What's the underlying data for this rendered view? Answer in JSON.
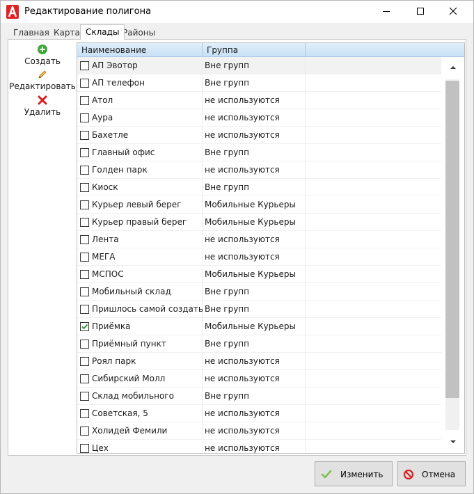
{
  "window": {
    "title": "Редактирование полигона",
    "app_icon": "app-logo-a-icon",
    "controls": [
      "minimize-icon",
      "maximize-icon",
      "close-icon"
    ]
  },
  "tabs": [
    {
      "label": "Главная",
      "active": false
    },
    {
      "label": "Карта",
      "active": false
    },
    {
      "label": "Склады",
      "active": true
    },
    {
      "label": "Районы",
      "active": false
    }
  ],
  "toolbar": {
    "create_label": "Создать",
    "edit_label": "Редактировать",
    "delete_label": "Удалить"
  },
  "grid": {
    "columns": [
      "Наименование",
      "Группа"
    ],
    "rows": [
      {
        "name": "АП Эвотор",
        "group": "Вне групп",
        "checked": false
      },
      {
        "name": "АП телефон",
        "group": "Вне групп",
        "checked": false
      },
      {
        "name": "Атол",
        "group": "не используются",
        "checked": false
      },
      {
        "name": "Аура",
        "group": "не используются",
        "checked": false
      },
      {
        "name": "Бахетле",
        "group": "не используются",
        "checked": false
      },
      {
        "name": "Главный офис",
        "group": "Вне групп",
        "checked": false
      },
      {
        "name": "Голден парк",
        "group": "не используются",
        "checked": false
      },
      {
        "name": "Киоск",
        "group": "Вне групп",
        "checked": false
      },
      {
        "name": "Курьер левый берег",
        "group": "Мобильные Курьеры",
        "checked": false
      },
      {
        "name": "Курьер правый берег",
        "group": "Мобильные Курьеры",
        "checked": false
      },
      {
        "name": "Лента",
        "group": "не используются",
        "checked": false
      },
      {
        "name": "МЕГА",
        "group": "не используются",
        "checked": false
      },
      {
        "name": "МСПОС",
        "group": "Мобильные Курьеры",
        "checked": false
      },
      {
        "name": "Мобильный склад",
        "group": "Вне групп",
        "checked": false
      },
      {
        "name": "Пришлось самой создать",
        "group": "Вне групп",
        "checked": false
      },
      {
        "name": "Приёмка",
        "group": "Мобильные Курьеры",
        "checked": true
      },
      {
        "name": "Приёмный пункт",
        "group": "Вне групп",
        "checked": false
      },
      {
        "name": "Роял парк",
        "group": "не используются",
        "checked": false
      },
      {
        "name": "Сибирский Молл",
        "group": "не используются",
        "checked": false
      },
      {
        "name": "Склад мобильного",
        "group": "Вне групп",
        "checked": false
      },
      {
        "name": "Советская, 5",
        "group": "не используются",
        "checked": false
      },
      {
        "name": "Холидей Фемили",
        "group": "не используются",
        "checked": false
      },
      {
        "name": "Цех",
        "group": "не используются",
        "checked": false
      }
    ]
  },
  "buttons": {
    "apply_label": "Изменить",
    "cancel_label": "Отмена"
  },
  "colors": {
    "header_bg": "#c9e1f5",
    "create_icon": "#3aa832",
    "delete_icon": "#d42020",
    "check_mark": "#2a8a2a",
    "cancel_icon": "#d42020",
    "app_logo": "#e02424"
  }
}
